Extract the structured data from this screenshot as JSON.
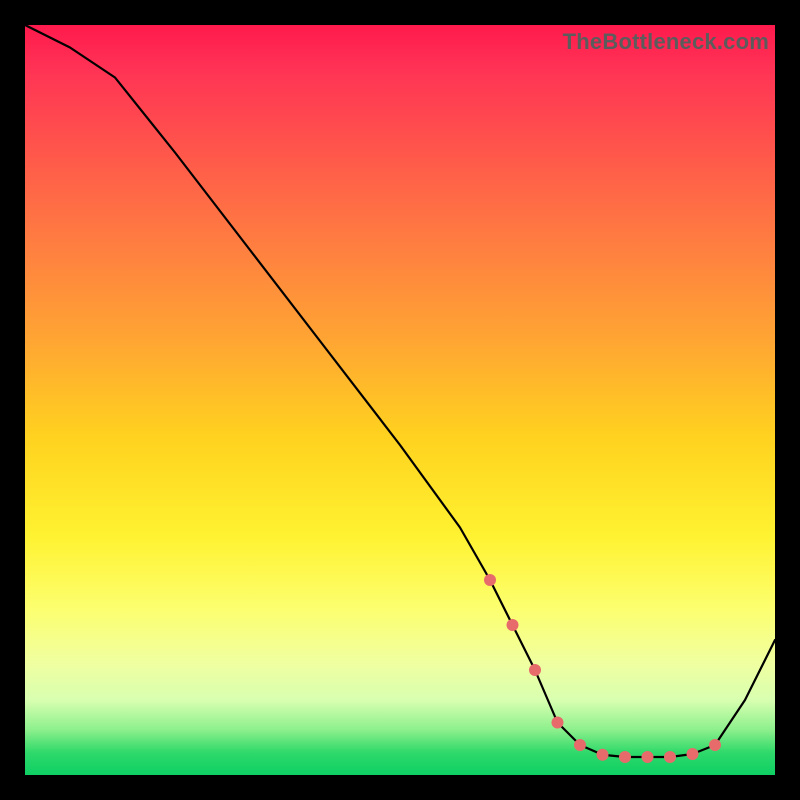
{
  "attribution": "TheBottleneck.com",
  "chart_data": {
    "type": "line",
    "title": "",
    "xlabel": "",
    "ylabel": "",
    "xlim": [
      0,
      100
    ],
    "ylim": [
      0,
      100
    ],
    "series": [
      {
        "name": "curve",
        "x": [
          0,
          6,
          12,
          20,
          30,
          40,
          50,
          58,
          62,
          65,
          68,
          71,
          74,
          77,
          80,
          83,
          86,
          89,
          92,
          96,
          100
        ],
        "values": [
          100,
          97,
          93,
          83,
          70,
          57,
          44,
          33,
          26,
          20,
          14,
          7,
          4,
          2.7,
          2.4,
          2.4,
          2.4,
          2.8,
          4.0,
          10,
          18
        ],
        "color": "#000000"
      }
    ],
    "markers": {
      "name": "dots",
      "x": [
        62,
        65,
        68,
        71,
        74,
        77,
        80,
        83,
        86,
        89,
        92
      ],
      "values": [
        26,
        20,
        14,
        7,
        4,
        2.7,
        2.4,
        2.4,
        2.4,
        2.8,
        4.0
      ],
      "color": "#e86b6b",
      "radius": 6
    }
  }
}
